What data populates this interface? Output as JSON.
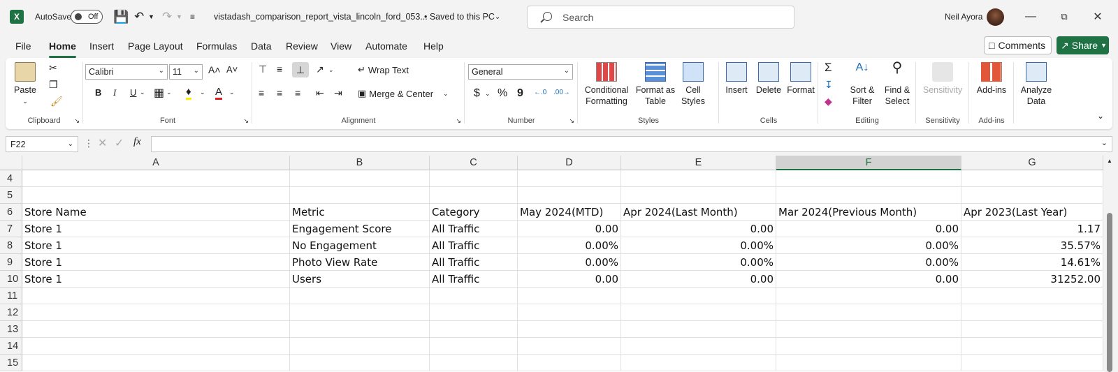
{
  "titlebar": {
    "app_icon": "excel-icon",
    "autosave_label": "AutoSave",
    "autosave_state": "Off",
    "filename": "vistadash_comparison_report_vista_lincoln_ford_053...",
    "save_status": "• Saved to this PC",
    "search_placeholder": "Search",
    "user_name": "Neil Ayora"
  },
  "menus": [
    "File",
    "Home",
    "Insert",
    "Page Layout",
    "Formulas",
    "Data",
    "Review",
    "View",
    "Automate",
    "Help"
  ],
  "active_menu": "Home",
  "actions": {
    "comments": "Comments",
    "share": "Share"
  },
  "ribbon": {
    "clipboard": {
      "label": "Clipboard",
      "paste": "Paste"
    },
    "font": {
      "label": "Font",
      "name": "Calibri",
      "size": "11",
      "bold": "B",
      "italic": "I",
      "underline": "U"
    },
    "alignment": {
      "label": "Alignment",
      "wrap": "Wrap Text",
      "merge": "Merge & Center"
    },
    "number": {
      "label": "Number",
      "format": "General",
      "currency": "$",
      "percent": "%",
      "comma": "9"
    },
    "styles": {
      "label": "Styles",
      "conditional": [
        "Conditional",
        "Formatting"
      ],
      "format_table": [
        "Format as",
        "Table"
      ],
      "cell_styles": [
        "Cell",
        "Styles"
      ]
    },
    "cells": {
      "label": "Cells",
      "insert": "Insert",
      "delete": "Delete",
      "format": "Format"
    },
    "editing": {
      "label": "Editing",
      "sort": [
        "Sort &",
        "Filter"
      ],
      "find": [
        "Find &",
        "Select"
      ]
    },
    "sensitivity": {
      "label": "Sensitivity",
      "button": "Sensitivity"
    },
    "addins": {
      "label": "Add-ins",
      "button": "Add-ins"
    },
    "analyze": {
      "button": [
        "Analyze",
        "Data"
      ]
    }
  },
  "formula_bar": {
    "name_box": "F22",
    "fx": "fx",
    "value": ""
  },
  "sheet": {
    "columns": [
      "A",
      "B",
      "C",
      "D",
      "E",
      "F",
      "G"
    ],
    "selected_column": "F",
    "rows": [
      {
        "num": "4",
        "cells": [
          "",
          "",
          "",
          "",
          "",
          "",
          ""
        ]
      },
      {
        "num": "5",
        "cells": [
          "",
          "",
          "",
          "",
          "",
          "",
          ""
        ]
      },
      {
        "num": "6",
        "cells": [
          "Store Name",
          "Metric",
          "Category",
          "May 2024(MTD)",
          "Apr 2024(Last Month)",
          "Mar 2024(Previous Month)",
          "Apr 2023(Last Year)"
        ]
      },
      {
        "num": "7",
        "cells": [
          "Store 1",
          "Engagement Score",
          "All Traffic",
          "0.00",
          "0.00",
          "0.00",
          "1.17"
        ]
      },
      {
        "num": "8",
        "cells": [
          "Store 1",
          "No Engagement",
          "All Traffic",
          "0.00%",
          "0.00%",
          "0.00%",
          "35.57%"
        ]
      },
      {
        "num": "9",
        "cells": [
          "Store 1",
          "Photo View Rate",
          "All Traffic",
          "0.00%",
          "0.00%",
          "0.00%",
          "14.61%"
        ]
      },
      {
        "num": "10",
        "cells": [
          "Store 1",
          "Users",
          "All Traffic",
          "0.00",
          "0.00",
          "0.00",
          "31252.00"
        ]
      },
      {
        "num": "11",
        "cells": [
          "",
          "",
          "",
          "",
          "",
          "",
          ""
        ]
      },
      {
        "num": "12",
        "cells": [
          "",
          "",
          "",
          "",
          "",
          "",
          ""
        ]
      },
      {
        "num": "13",
        "cells": [
          "",
          "",
          "",
          "",
          "",
          "",
          ""
        ]
      },
      {
        "num": "14",
        "cells": [
          "",
          "",
          "",
          "",
          "",
          "",
          ""
        ]
      },
      {
        "num": "15",
        "cells": [
          "",
          "",
          "",
          "",
          "",
          "",
          ""
        ]
      }
    ]
  }
}
